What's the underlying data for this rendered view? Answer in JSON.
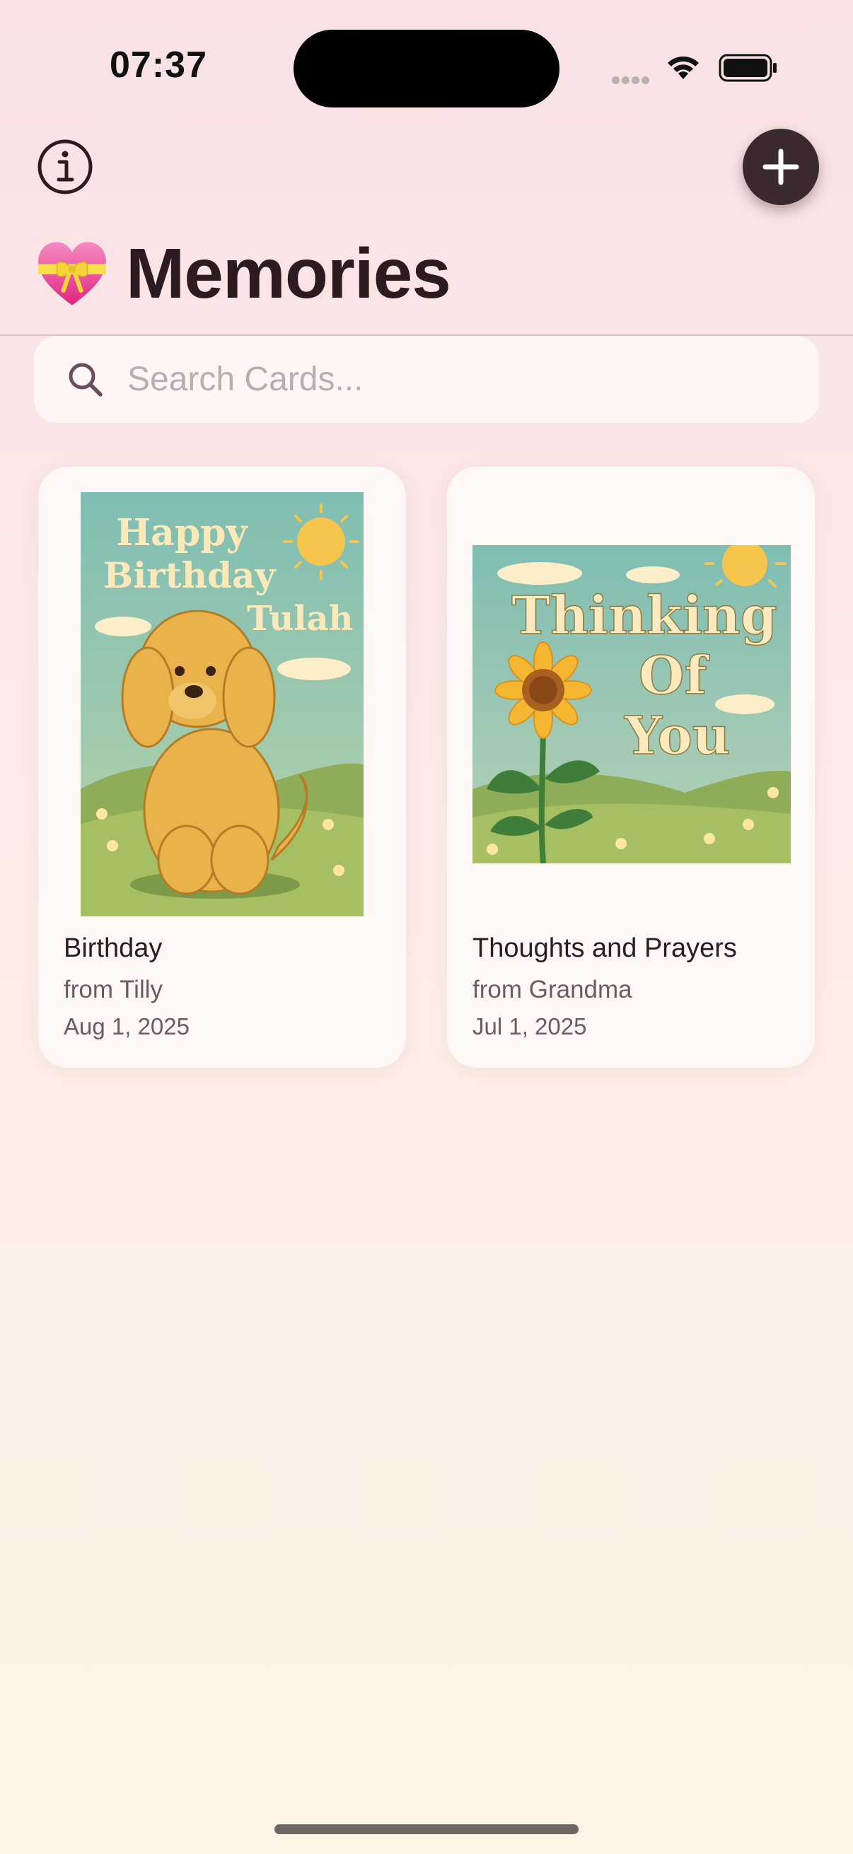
{
  "status_bar": {
    "time": "07:37"
  },
  "header": {
    "title": "Memories"
  },
  "search": {
    "placeholder": "Search Cards..."
  },
  "cards": [
    {
      "title": "Birthday",
      "from": "from Tilly",
      "date": "Aug 1, 2025",
      "image_text": [
        "Happy",
        "Birthday",
        "Tulah"
      ]
    },
    {
      "title": "Thoughts and Prayers",
      "from": "from Grandma",
      "date": "Jul 1, 2025",
      "image_text": [
        "Thinking",
        "Of",
        "You"
      ]
    }
  ],
  "icons": {
    "info": "info-icon",
    "add": "plus-icon",
    "title_emoji": "heart-with-ribbon-icon",
    "search": "search-icon"
  },
  "colors": {
    "accent_dark": "#3a2a2f",
    "background_top": "#f9e1e5",
    "background_bottom": "#fdf4e6",
    "card": "#fdf7f6"
  }
}
